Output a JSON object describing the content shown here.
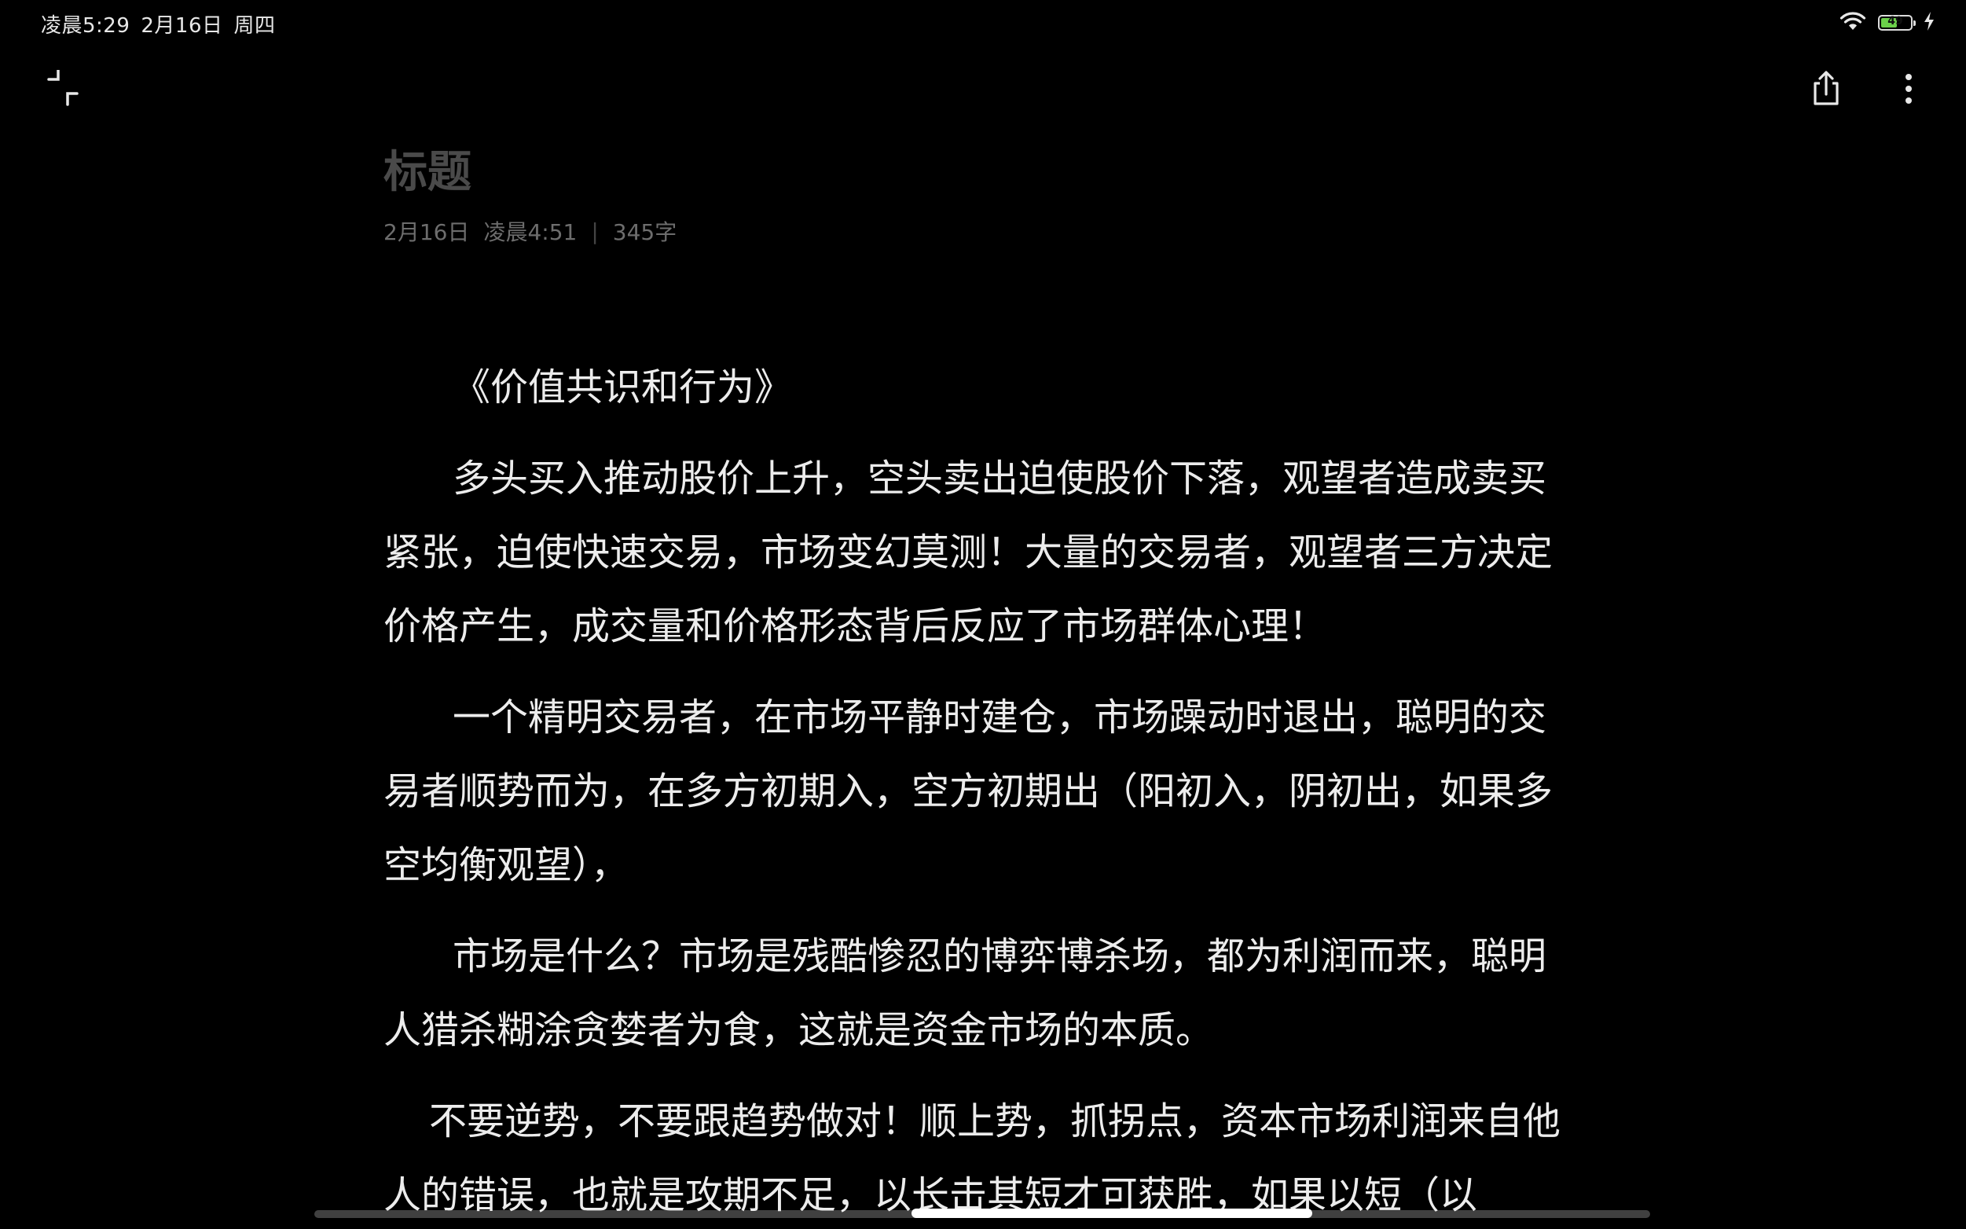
{
  "status_bar": {
    "time": "凌晨5:29",
    "date": "2月16日",
    "weekday": "周四",
    "battery": "49"
  },
  "toolbar": {
    "collapse_icon": "collapse-fullscreen-icon",
    "share_icon": "share-icon",
    "more_icon": "more-vertical-icon"
  },
  "note": {
    "title": "标题",
    "date": "2月16日",
    "time": "凌晨4:51",
    "separator": "|",
    "word_count": "345字",
    "paragraphs": [
      "《价值共识和行为》",
      "多头买入推动股价上升，空头卖出迫使股价下落，观望者造成卖买紧张，迫使快速交易，市场变幻莫测！大量的交易者，观望者三方决定价格产生，成交量和价格形态背后反应了市场群体心理！",
      "一个精明交易者，在市场平静时建仓，市场躁动时退出，聪明的交易者顺势而为，在多方初期入，空方初期出（阳初入，阴初出，如果多空均衡观望），",
      "市场是什么？市场是残酷惨忍的博弈博杀场，都为利润而来，聪明人猎杀糊涂贪婪者为食，这就是资金市场的本质。",
      "不要逆势，不要跟趋势做对！顺上势，抓拐点，资本市场利润来自他人的错误，也就是攻期不足，以长击其短才可获胜，如果以短（以"
    ]
  },
  "colors": {
    "background": "#000000",
    "title_placeholder": "#4a4a4a",
    "meta_text": "#6d6d6d",
    "body_text": "#ececec",
    "battery": "#6bd04a"
  }
}
